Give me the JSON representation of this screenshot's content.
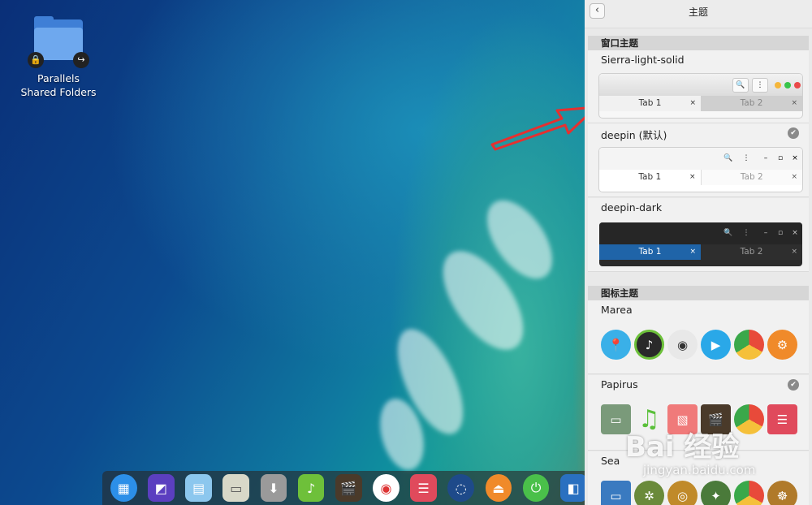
{
  "desktop": {
    "icon_label": "Parallels Shared Folders"
  },
  "panel": {
    "title": "主题",
    "window_theme_section": "窗口主题",
    "icon_theme_section": "图标主题",
    "window_themes": [
      {
        "name": "Sierra-light-solid",
        "tab1": "Tab 1",
        "tab2": "Tab 2",
        "close": "×"
      },
      {
        "name": "deepin (默认)",
        "tab1": "Tab 1",
        "tab2": "Tab 2",
        "close": "×"
      },
      {
        "name": "deepin-dark",
        "tab1": "Tab 1",
        "tab2": "Tab 2",
        "close": "×"
      }
    ],
    "icon_themes": [
      {
        "name": "Marea"
      },
      {
        "name": "Papirus"
      },
      {
        "name": "Sea"
      }
    ],
    "window_controls": {
      "minimize": "–",
      "maximize": "▫",
      "close": "×"
    }
  },
  "watermark": {
    "text": "Bai 经验",
    "url": "jingyan.baidu.com"
  },
  "colors": {
    "panel_bg": "#e9e9e9",
    "deepin_dark_tab_active": "#1f64a8",
    "red_arrow": "#e53030"
  }
}
